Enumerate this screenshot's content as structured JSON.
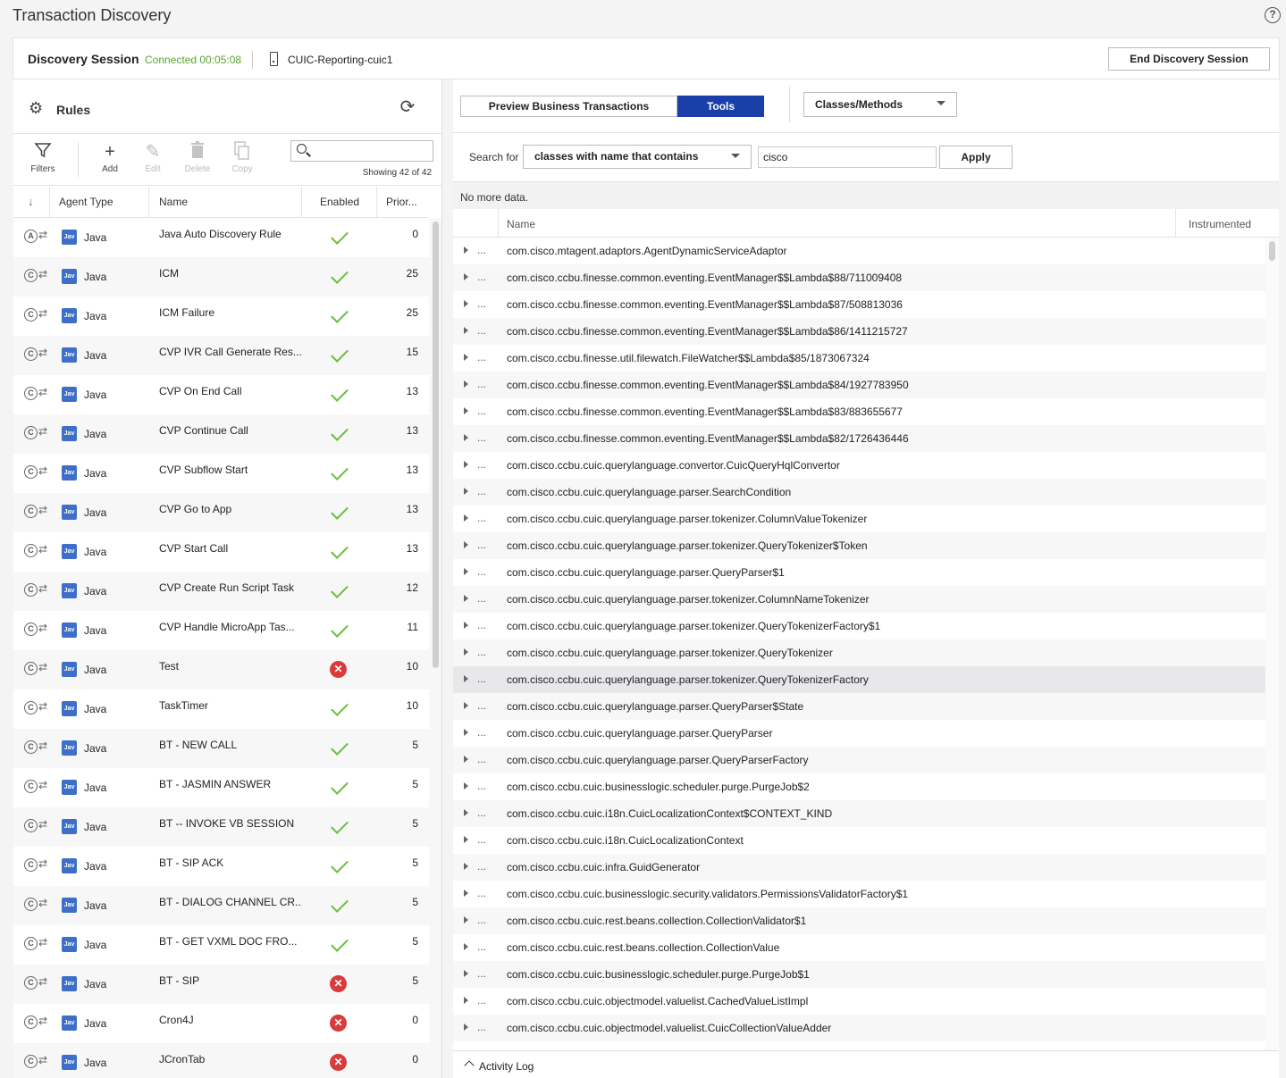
{
  "header": {
    "title": "Transaction Discovery",
    "help": "?"
  },
  "session": {
    "label": "Discovery Session",
    "status": "Connected 00:05:08",
    "server": "CUIC-Reporting-cuic1",
    "end_button": "End Discovery Session",
    "status_color": "#5aa52f"
  },
  "rules": {
    "title": "Rules",
    "toolbar": {
      "filters": "Filters",
      "add": "Add",
      "edit": "Edit",
      "delete": "Delete",
      "copy": "Copy"
    },
    "search_placeholder": "",
    "showing": "Showing 42 of 42",
    "columns": {
      "agent_type": "Agent Type",
      "name": "Name",
      "enabled": "Enabled",
      "priority": "Prior..."
    },
    "rows": [
      {
        "type_letter": "A",
        "agent": "Java",
        "name": "Java Auto Discovery Rule",
        "enabled": true,
        "priority": "0"
      },
      {
        "type_letter": "C",
        "agent": "Java",
        "name": "ICM",
        "enabled": true,
        "priority": "25"
      },
      {
        "type_letter": "C",
        "agent": "Java",
        "name": "ICM Failure",
        "enabled": true,
        "priority": "25"
      },
      {
        "type_letter": "C",
        "agent": "Java",
        "name": "CVP IVR Call Generate Res...",
        "enabled": true,
        "priority": "15"
      },
      {
        "type_letter": "C",
        "agent": "Java",
        "name": "CVP On End Call",
        "enabled": true,
        "priority": "13"
      },
      {
        "type_letter": "C",
        "agent": "Java",
        "name": "CVP Continue Call",
        "enabled": true,
        "priority": "13"
      },
      {
        "type_letter": "C",
        "agent": "Java",
        "name": "CVP Subflow Start",
        "enabled": true,
        "priority": "13"
      },
      {
        "type_letter": "C",
        "agent": "Java",
        "name": "CVP Go to App",
        "enabled": true,
        "priority": "13"
      },
      {
        "type_letter": "C",
        "agent": "Java",
        "name": "CVP Start Call",
        "enabled": true,
        "priority": "13"
      },
      {
        "type_letter": "C",
        "agent": "Java",
        "name": "CVP Create Run Script Task",
        "enabled": true,
        "priority": "12"
      },
      {
        "type_letter": "C",
        "agent": "Java",
        "name": "CVP Handle MicroApp Tas...",
        "enabled": true,
        "priority": "11"
      },
      {
        "type_letter": "C",
        "agent": "Java",
        "name": "Test",
        "enabled": false,
        "priority": "10"
      },
      {
        "type_letter": "C",
        "agent": "Java",
        "name": "TaskTimer",
        "enabled": true,
        "priority": "10"
      },
      {
        "type_letter": "C",
        "agent": "Java",
        "name": "BT - NEW CALL",
        "enabled": true,
        "priority": "5"
      },
      {
        "type_letter": "C",
        "agent": "Java",
        "name": "BT - JASMIN ANSWER",
        "enabled": true,
        "priority": "5"
      },
      {
        "type_letter": "C",
        "agent": "Java",
        "name": "BT -- INVOKE VB SESSION",
        "enabled": true,
        "priority": "5"
      },
      {
        "type_letter": "C",
        "agent": "Java",
        "name": "BT - SIP ACK",
        "enabled": true,
        "priority": "5"
      },
      {
        "type_letter": "C",
        "agent": "Java",
        "name": "BT - DIALOG CHANNEL CR...",
        "enabled": true,
        "priority": "5"
      },
      {
        "type_letter": "C",
        "agent": "Java",
        "name": "BT - GET VXML DOC FRO...",
        "enabled": true,
        "priority": "5"
      },
      {
        "type_letter": "C",
        "agent": "Java",
        "name": "BT - SIP",
        "enabled": false,
        "priority": "5"
      },
      {
        "type_letter": "C",
        "agent": "Java",
        "name": "Cron4J",
        "enabled": false,
        "priority": "0"
      },
      {
        "type_letter": "C",
        "agent": "Java",
        "name": "JCronTab",
        "enabled": false,
        "priority": "0"
      }
    ]
  },
  "tools": {
    "tabs": {
      "preview": "Preview Business Transactions",
      "tools": "Tools"
    },
    "view_select": "Classes/Methods",
    "search_for_label": "Search for",
    "search_mode": "classes with name that contains",
    "search_value": "cisco",
    "apply": "Apply",
    "no_more_data": "No more data.",
    "columns": {
      "name": "Name",
      "instrumented": "Instrumented"
    },
    "classes": [
      "com.cisco.mtagent.adaptors.AgentDynamicServiceAdaptor",
      "com.cisco.ccbu.finesse.common.eventing.EventManager$$Lambda$88/711009408",
      "com.cisco.ccbu.finesse.common.eventing.EventManager$$Lambda$87/508813036",
      "com.cisco.ccbu.finesse.common.eventing.EventManager$$Lambda$86/1411215727",
      "com.cisco.ccbu.finesse.util.filewatch.FileWatcher$$Lambda$85/1873067324",
      "com.cisco.ccbu.finesse.common.eventing.EventManager$$Lambda$84/1927783950",
      "com.cisco.ccbu.finesse.common.eventing.EventManager$$Lambda$83/883655677",
      "com.cisco.ccbu.finesse.common.eventing.EventManager$$Lambda$82/1726436446",
      "com.cisco.ccbu.cuic.querylanguage.convertor.CuicQueryHqlConvertor",
      "com.cisco.ccbu.cuic.querylanguage.parser.SearchCondition",
      "com.cisco.ccbu.cuic.querylanguage.parser.tokenizer.ColumnValueTokenizer",
      "com.cisco.ccbu.cuic.querylanguage.parser.tokenizer.QueryTokenizer$Token",
      "com.cisco.ccbu.cuic.querylanguage.parser.QueryParser$1",
      "com.cisco.ccbu.cuic.querylanguage.parser.tokenizer.ColumnNameTokenizer",
      "com.cisco.ccbu.cuic.querylanguage.parser.tokenizer.QueryTokenizerFactory$1",
      "com.cisco.ccbu.cuic.querylanguage.parser.tokenizer.QueryTokenizer",
      "com.cisco.ccbu.cuic.querylanguage.parser.tokenizer.QueryTokenizerFactory",
      "com.cisco.ccbu.cuic.querylanguage.parser.QueryParser$State",
      "com.cisco.ccbu.cuic.querylanguage.parser.QueryParser",
      "com.cisco.ccbu.cuic.querylanguage.parser.QueryParserFactory",
      "com.cisco.ccbu.cuic.businesslogic.scheduler.purge.PurgeJob$2",
      "com.cisco.ccbu.cuic.i18n.CuicLocalizationContext$CONTEXT_KIND",
      "com.cisco.ccbu.cuic.i18n.CuicLocalizationContext",
      "com.cisco.ccbu.cuic.infra.GuidGenerator",
      "com.cisco.ccbu.cuic.businesslogic.security.validators.PermissionsValidatorFactory$1",
      "com.cisco.ccbu.cuic.rest.beans.collection.CollectionValidator$1",
      "com.cisco.ccbu.cuic.rest.beans.collection.CollectionValue",
      "com.cisco.ccbu.cuic.businesslogic.scheduler.purge.PurgeJob$1",
      "com.cisco.ccbu.cuic.objectmodel.valuelist.CachedValueListImpl",
      "com.cisco.ccbu.cuic.objectmodel.valuelist.CuicCollectionValueAdder"
    ],
    "highlighted_index": 16,
    "activity_log": "Activity Log"
  }
}
